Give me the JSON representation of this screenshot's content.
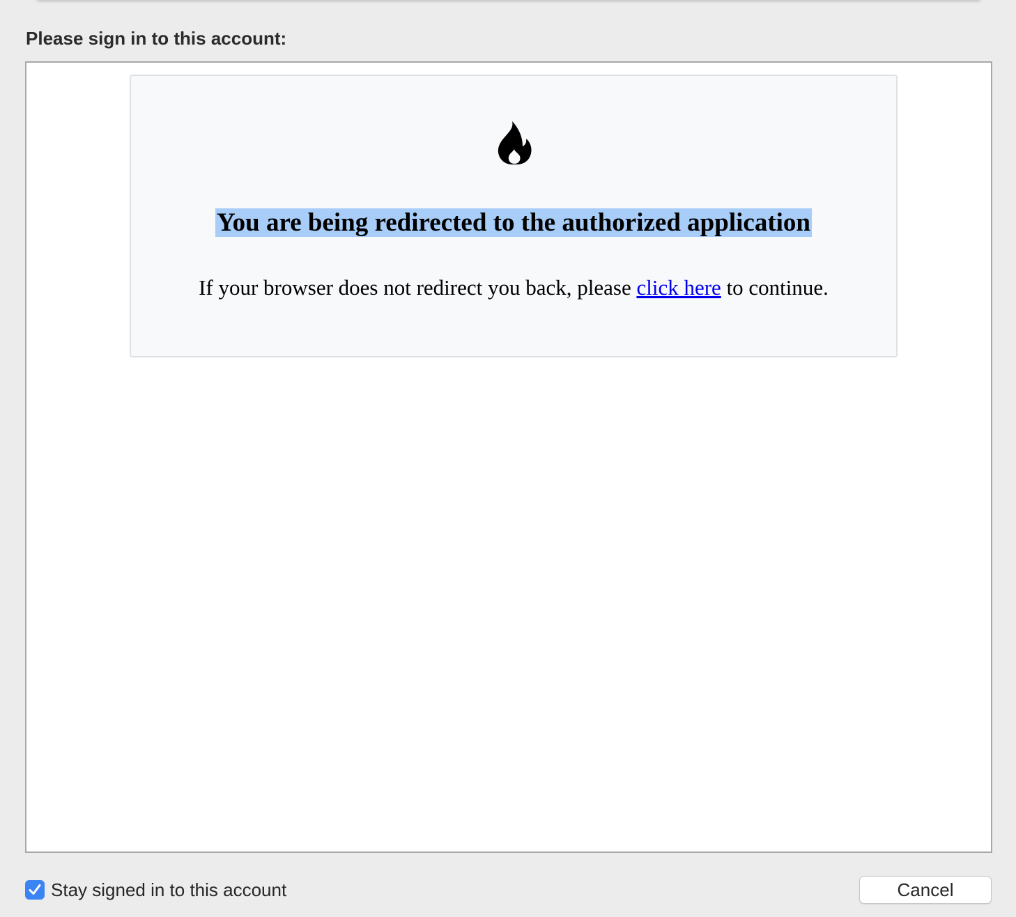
{
  "dialog": {
    "title": "Please sign in to this account:"
  },
  "web_content": {
    "icon": "fire-icon",
    "heading": "You are being redirected to the authorized application",
    "message_before": "If your browser does not redirect you back, please ",
    "link_text": "click here",
    "message_after": " to continue.",
    "heading_selection_color": "#a9cdf9",
    "link_color": "#0000ee"
  },
  "footer": {
    "stay_signed_in": {
      "label": "Stay signed in to this account",
      "checked": true
    },
    "cancel_label": "Cancel"
  },
  "colors": {
    "accent": "#3b84f4",
    "window_background": "#ececec"
  }
}
